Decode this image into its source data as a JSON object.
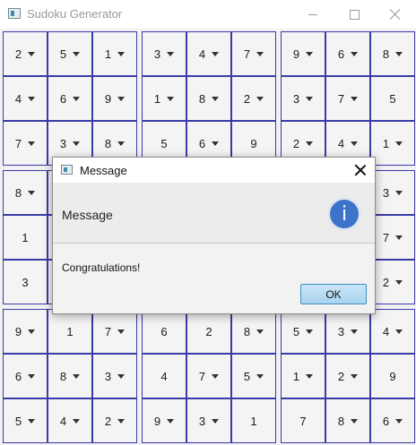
{
  "window": {
    "title": "Sudoku Generator"
  },
  "grid": {
    "rows": [
      [
        {
          "v": "2",
          "c": true
        },
        {
          "v": "5",
          "c": true
        },
        {
          "v": "1",
          "c": true
        },
        {
          "v": "3",
          "c": true
        },
        {
          "v": "4",
          "c": true
        },
        {
          "v": "7",
          "c": true
        },
        {
          "v": "9",
          "c": true
        },
        {
          "v": "6",
          "c": true
        },
        {
          "v": "8",
          "c": true
        }
      ],
      [
        {
          "v": "4",
          "c": true
        },
        {
          "v": "6",
          "c": true
        },
        {
          "v": "9",
          "c": true
        },
        {
          "v": "1",
          "c": true
        },
        {
          "v": "8",
          "c": true
        },
        {
          "v": "2",
          "c": true
        },
        {
          "v": "3",
          "c": true
        },
        {
          "v": "7",
          "c": true
        },
        {
          "v": "5",
          "c": false
        }
      ],
      [
        {
          "v": "7",
          "c": true
        },
        {
          "v": "3",
          "c": true
        },
        {
          "v": "8",
          "c": true
        },
        {
          "v": "5",
          "c": false
        },
        {
          "v": "6",
          "c": true
        },
        {
          "v": "9",
          "c": false
        },
        {
          "v": "2",
          "c": true
        },
        {
          "v": "4",
          "c": true
        },
        {
          "v": "1",
          "c": true
        }
      ],
      [
        {
          "v": "8",
          "c": true
        },
        {
          "v": "",
          "c": false
        },
        {
          "v": "",
          "c": false
        },
        {
          "v": "",
          "c": false
        },
        {
          "v": "",
          "c": false
        },
        {
          "v": "",
          "c": false
        },
        {
          "v": "",
          "c": false
        },
        {
          "v": "",
          "c": false
        },
        {
          "v": "3",
          "c": true
        }
      ],
      [
        {
          "v": "1",
          "c": false
        },
        {
          "v": "",
          "c": false
        },
        {
          "v": "",
          "c": false
        },
        {
          "v": "",
          "c": false
        },
        {
          "v": "",
          "c": false
        },
        {
          "v": "",
          "c": false
        },
        {
          "v": "",
          "c": false
        },
        {
          "v": "",
          "c": false
        },
        {
          "v": "7",
          "c": true
        }
      ],
      [
        {
          "v": "3",
          "c": false
        },
        {
          "v": "",
          "c": false
        },
        {
          "v": "",
          "c": false
        },
        {
          "v": "",
          "c": false
        },
        {
          "v": "",
          "c": false
        },
        {
          "v": "",
          "c": false
        },
        {
          "v": "",
          "c": false
        },
        {
          "v": "",
          "c": false
        },
        {
          "v": "2",
          "c": true
        }
      ],
      [
        {
          "v": "9",
          "c": true
        },
        {
          "v": "1",
          "c": false
        },
        {
          "v": "7",
          "c": true
        },
        {
          "v": "6",
          "c": false
        },
        {
          "v": "2",
          "c": false
        },
        {
          "v": "8",
          "c": true
        },
        {
          "v": "5",
          "c": true
        },
        {
          "v": "3",
          "c": true
        },
        {
          "v": "4",
          "c": true
        }
      ],
      [
        {
          "v": "6",
          "c": true
        },
        {
          "v": "8",
          "c": true
        },
        {
          "v": "3",
          "c": true
        },
        {
          "v": "4",
          "c": false
        },
        {
          "v": "7",
          "c": true
        },
        {
          "v": "5",
          "c": true
        },
        {
          "v": "1",
          "c": true
        },
        {
          "v": "2",
          "c": true
        },
        {
          "v": "9",
          "c": false
        }
      ],
      [
        {
          "v": "5",
          "c": true
        },
        {
          "v": "4",
          "c": true
        },
        {
          "v": "2",
          "c": true
        },
        {
          "v": "9",
          "c": true
        },
        {
          "v": "3",
          "c": true
        },
        {
          "v": "1",
          "c": false
        },
        {
          "v": "7",
          "c": false
        },
        {
          "v": "8",
          "c": true
        },
        {
          "v": "6",
          "c": true
        }
      ]
    ]
  },
  "dialog": {
    "title": "Message",
    "header": "Message",
    "content": "Congratulations!",
    "ok_label": "OK",
    "info_glyph": "i"
  },
  "icons": {
    "info": "info-icon",
    "close": "close-icon",
    "minimize": "minimize-icon",
    "maximize": "maximize-icon"
  },
  "colors": {
    "grid_border": "#1f1fb8",
    "ok_button": "#a9d3ee",
    "info_blue": "#3d74c9"
  }
}
